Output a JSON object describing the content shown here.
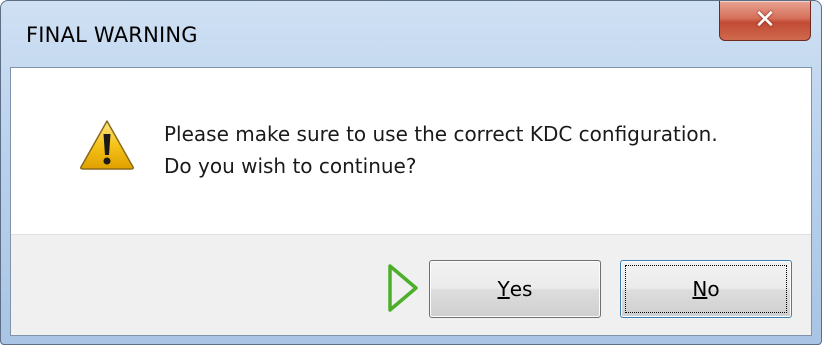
{
  "dialog": {
    "title": "FINAL WARNING",
    "close_icon": "close-icon",
    "warning_icon": "warning-triangle-icon",
    "default_indicator_icon": "play-arrow-icon",
    "message_lines": [
      "Please make sure to use the correct KDC configuration.",
      "Do you wish to continue?"
    ],
    "buttons": {
      "yes": {
        "accel": "Y",
        "rest": "es"
      },
      "no": {
        "accel": "N",
        "rest": "o"
      }
    },
    "colors": {
      "frame": "#b9d1ec",
      "close_button": "#c24a34",
      "warning_yellow": "#f5c318",
      "arrow_green": "#4caf2a"
    }
  }
}
